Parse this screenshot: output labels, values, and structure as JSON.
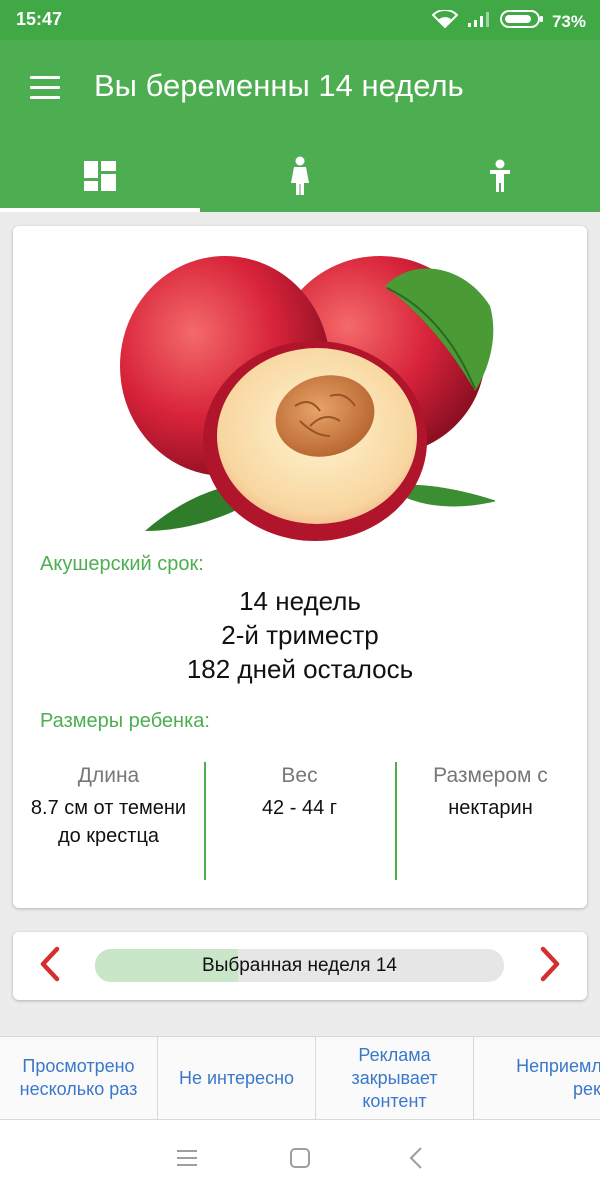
{
  "status_bar": {
    "time": "15:47",
    "battery": "73%"
  },
  "app_bar": {
    "title": "Вы беременны 14 недель",
    "tabs": [
      {
        "icon": "dashboard-icon",
        "active": true
      },
      {
        "icon": "pregnant-woman-icon",
        "active": false
      },
      {
        "icon": "child-icon",
        "active": false
      }
    ],
    "color": "#4cae50"
  },
  "card": {
    "image": "nectarine-fruit-image",
    "term_label": "Акушерский срок:",
    "term_lines": [
      "14 недель",
      "2-й триместр",
      "182 дней осталось"
    ],
    "sizes_label": "Размеры ребенка:",
    "sizes": [
      {
        "caption": "Длина",
        "value": "8.7 см от темени до крестца"
      },
      {
        "caption": "Вес",
        "value": "42 - 44 г"
      },
      {
        "caption": "Размером с",
        "value": "нектарин"
      }
    ]
  },
  "week_selector": {
    "label": "Выбранная неделя 14",
    "progress": 0.35,
    "prev_icon": "chevron-left-icon",
    "next_icon": "chevron-right-icon",
    "arrow_color": "#d32f2f"
  },
  "ad_feedback": {
    "options": [
      "Просмотрено несколько раз",
      "Не интересно",
      "Реклама закрывает контент",
      "Неприемлемая реклама"
    ]
  },
  "nav_bar": {
    "buttons": [
      "menu-icon",
      "home-square-icon",
      "back-icon"
    ]
  }
}
